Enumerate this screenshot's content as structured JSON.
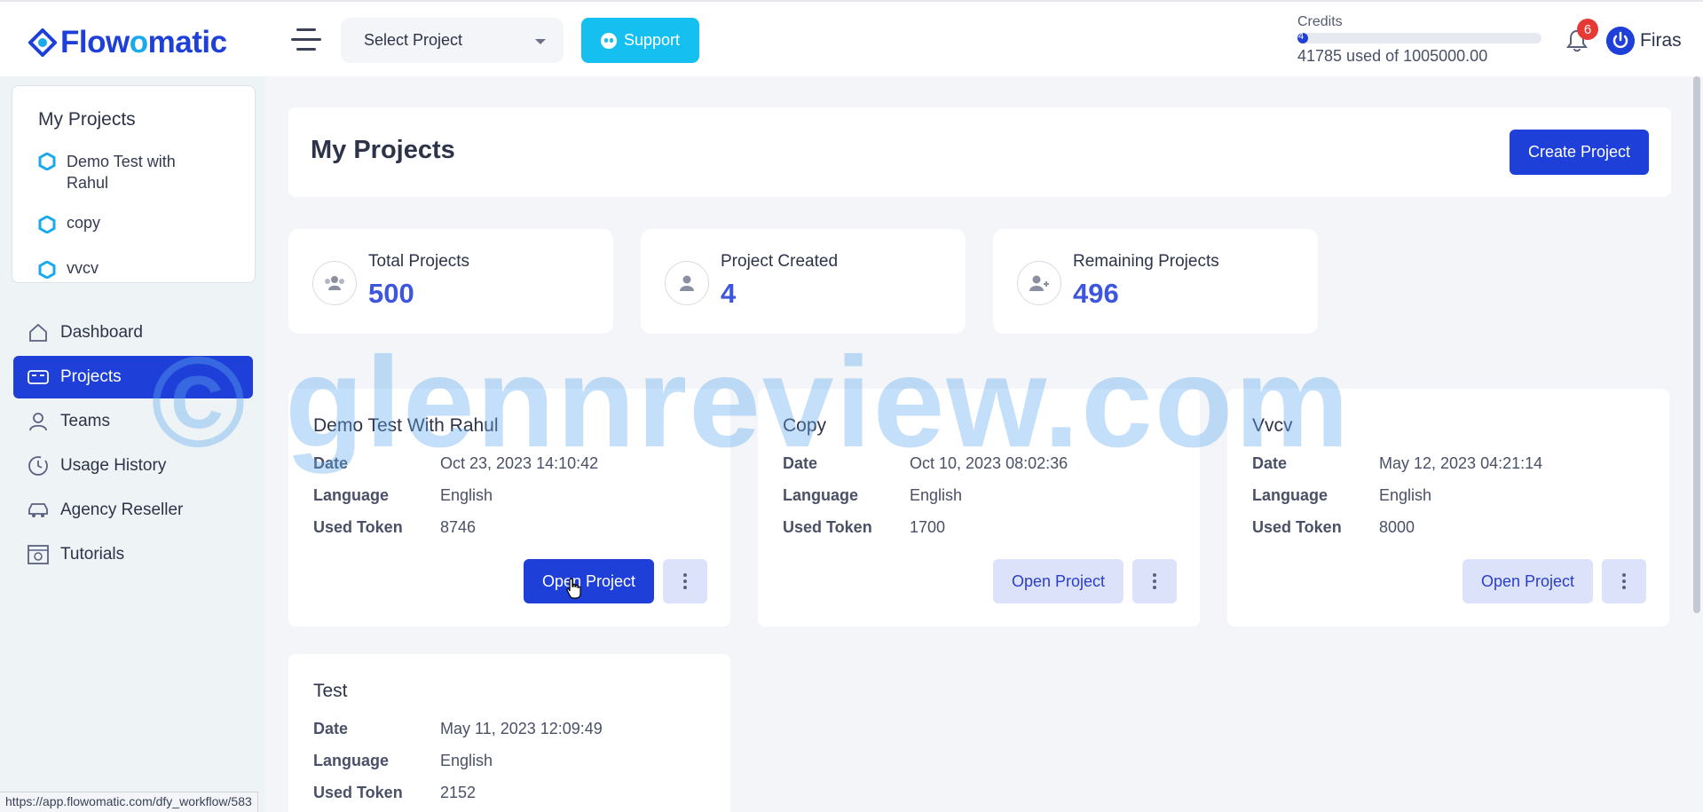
{
  "header": {
    "logo_prefix": "Flow",
    "logo_o": "o",
    "logo_suffix": "matic",
    "select_project": "Select Project",
    "support_label": "Support",
    "credits_label": "Credits",
    "credits_bar_number": "4",
    "credits_used_text": "41785 used of 1005000.00",
    "credits_fraction": 0.042,
    "notification_count": "6",
    "user_name": "Firas"
  },
  "sidebar": {
    "my_projects_title": "My Projects",
    "my_projects": [
      {
        "label": "Demo Test with Rahul"
      },
      {
        "label": "copy"
      },
      {
        "label": "vvcv"
      }
    ],
    "nav": [
      {
        "label": "Dashboard",
        "icon": "home-icon"
      },
      {
        "label": "Projects",
        "icon": "projects-icon",
        "active": true
      },
      {
        "label": "Teams",
        "icon": "user-icon"
      },
      {
        "label": "Usage History",
        "icon": "history-icon"
      },
      {
        "label": "Agency Reseller",
        "icon": "car-icon"
      },
      {
        "label": "Tutorials",
        "icon": "tutorials-icon"
      }
    ]
  },
  "main": {
    "title": "My Projects",
    "create_button": "Create Project",
    "stats": [
      {
        "label": "Total Projects",
        "value": "500",
        "icon": "users-icon"
      },
      {
        "label": "Project Created",
        "value": "4",
        "icon": "user-icon"
      },
      {
        "label": "Remaining Projects",
        "value": "496",
        "icon": "user-plus-icon"
      }
    ],
    "field_labels": {
      "date": "Date",
      "language": "Language",
      "used_token": "Used Token"
    },
    "open_button": "Open Project",
    "projects": [
      {
        "name": "Demo Test With Rahul",
        "date": "Oct 23, 2023 14:10:42",
        "language": "English",
        "used_token": "8746"
      },
      {
        "name": "Copy",
        "date": "Oct 10, 2023 08:02:36",
        "language": "English",
        "used_token": "1700"
      },
      {
        "name": "Vvcv",
        "date": "May 12, 2023 04:21:14",
        "language": "English",
        "used_token": "8000"
      },
      {
        "name": "Test",
        "date": "May 11, 2023 12:09:49",
        "language": "English",
        "used_token": "2152"
      }
    ]
  },
  "watermark": "© glennreview.com",
  "status_url": "https://app.flowomatic.com/dfy_workflow/583",
  "colors": {
    "brand": "#1e3fd8",
    "support": "#15bff0",
    "badge": "#e53935",
    "stat_value": "#3d56e0"
  }
}
